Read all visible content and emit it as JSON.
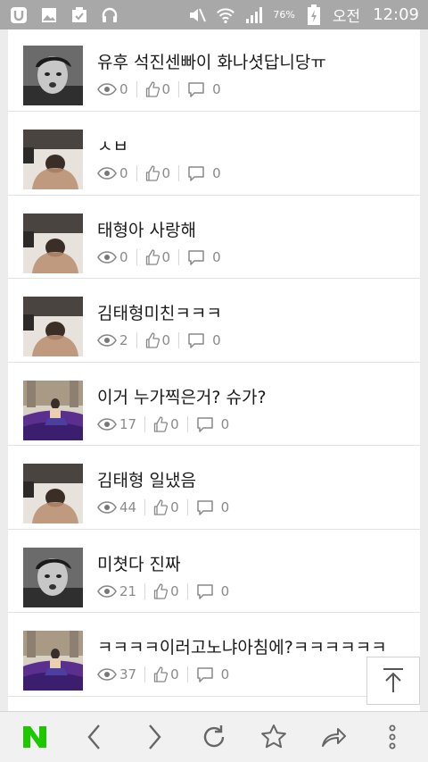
{
  "status_bar": {
    "battery_percent": "76%",
    "ampm": "오전",
    "time": "12:09",
    "left_icons": [
      "app-u-icon",
      "gallery-icon",
      "clipboard-check-icon",
      "headset-icon"
    ],
    "right_icons": [
      "mute-icon",
      "wifi-icon",
      "signal-icon",
      "battery-charging-icon"
    ]
  },
  "posts": [
    {
      "title": "유후 석진센빠이 화나셧답니당ㅠ",
      "views": "0",
      "likes": "0",
      "comments": "0",
      "thumb": "face"
    },
    {
      "title": "ㅅㅂ",
      "views": "0",
      "likes": "0",
      "comments": "0",
      "thumb": "back"
    },
    {
      "title": "태형아 사랑해",
      "views": "0",
      "likes": "0",
      "comments": "0",
      "thumb": "back"
    },
    {
      "title": "김태형미친ㅋㅋㅋ",
      "views": "2",
      "likes": "0",
      "comments": "0",
      "thumb": "back"
    },
    {
      "title": "이거 누가찍은거? 슈가?",
      "views": "17",
      "likes": "0",
      "comments": "0",
      "thumb": "bed"
    },
    {
      "title": "김태형 일냈음",
      "views": "44",
      "likes": "0",
      "comments": "0",
      "thumb": "back"
    },
    {
      "title": "미쳣다 진짜",
      "views": "21",
      "likes": "0",
      "comments": "0",
      "thumb": "face"
    },
    {
      "title": "ㅋㅋㅋㅋ이러고노냐아침에?ㅋㅋㅋㅋㅋㅋ",
      "views": "37",
      "likes": "0",
      "comments": "0",
      "thumb": "bed"
    }
  ],
  "bottom_nav": [
    "naver-home-icon",
    "back-icon",
    "forward-icon",
    "refresh-icon",
    "bookmark-star-icon",
    "share-icon",
    "more-icon"
  ],
  "colors": {
    "naver_green": "#1ec800",
    "status_bar": "#a8a8a8",
    "meta_text": "#8a8a8a"
  }
}
